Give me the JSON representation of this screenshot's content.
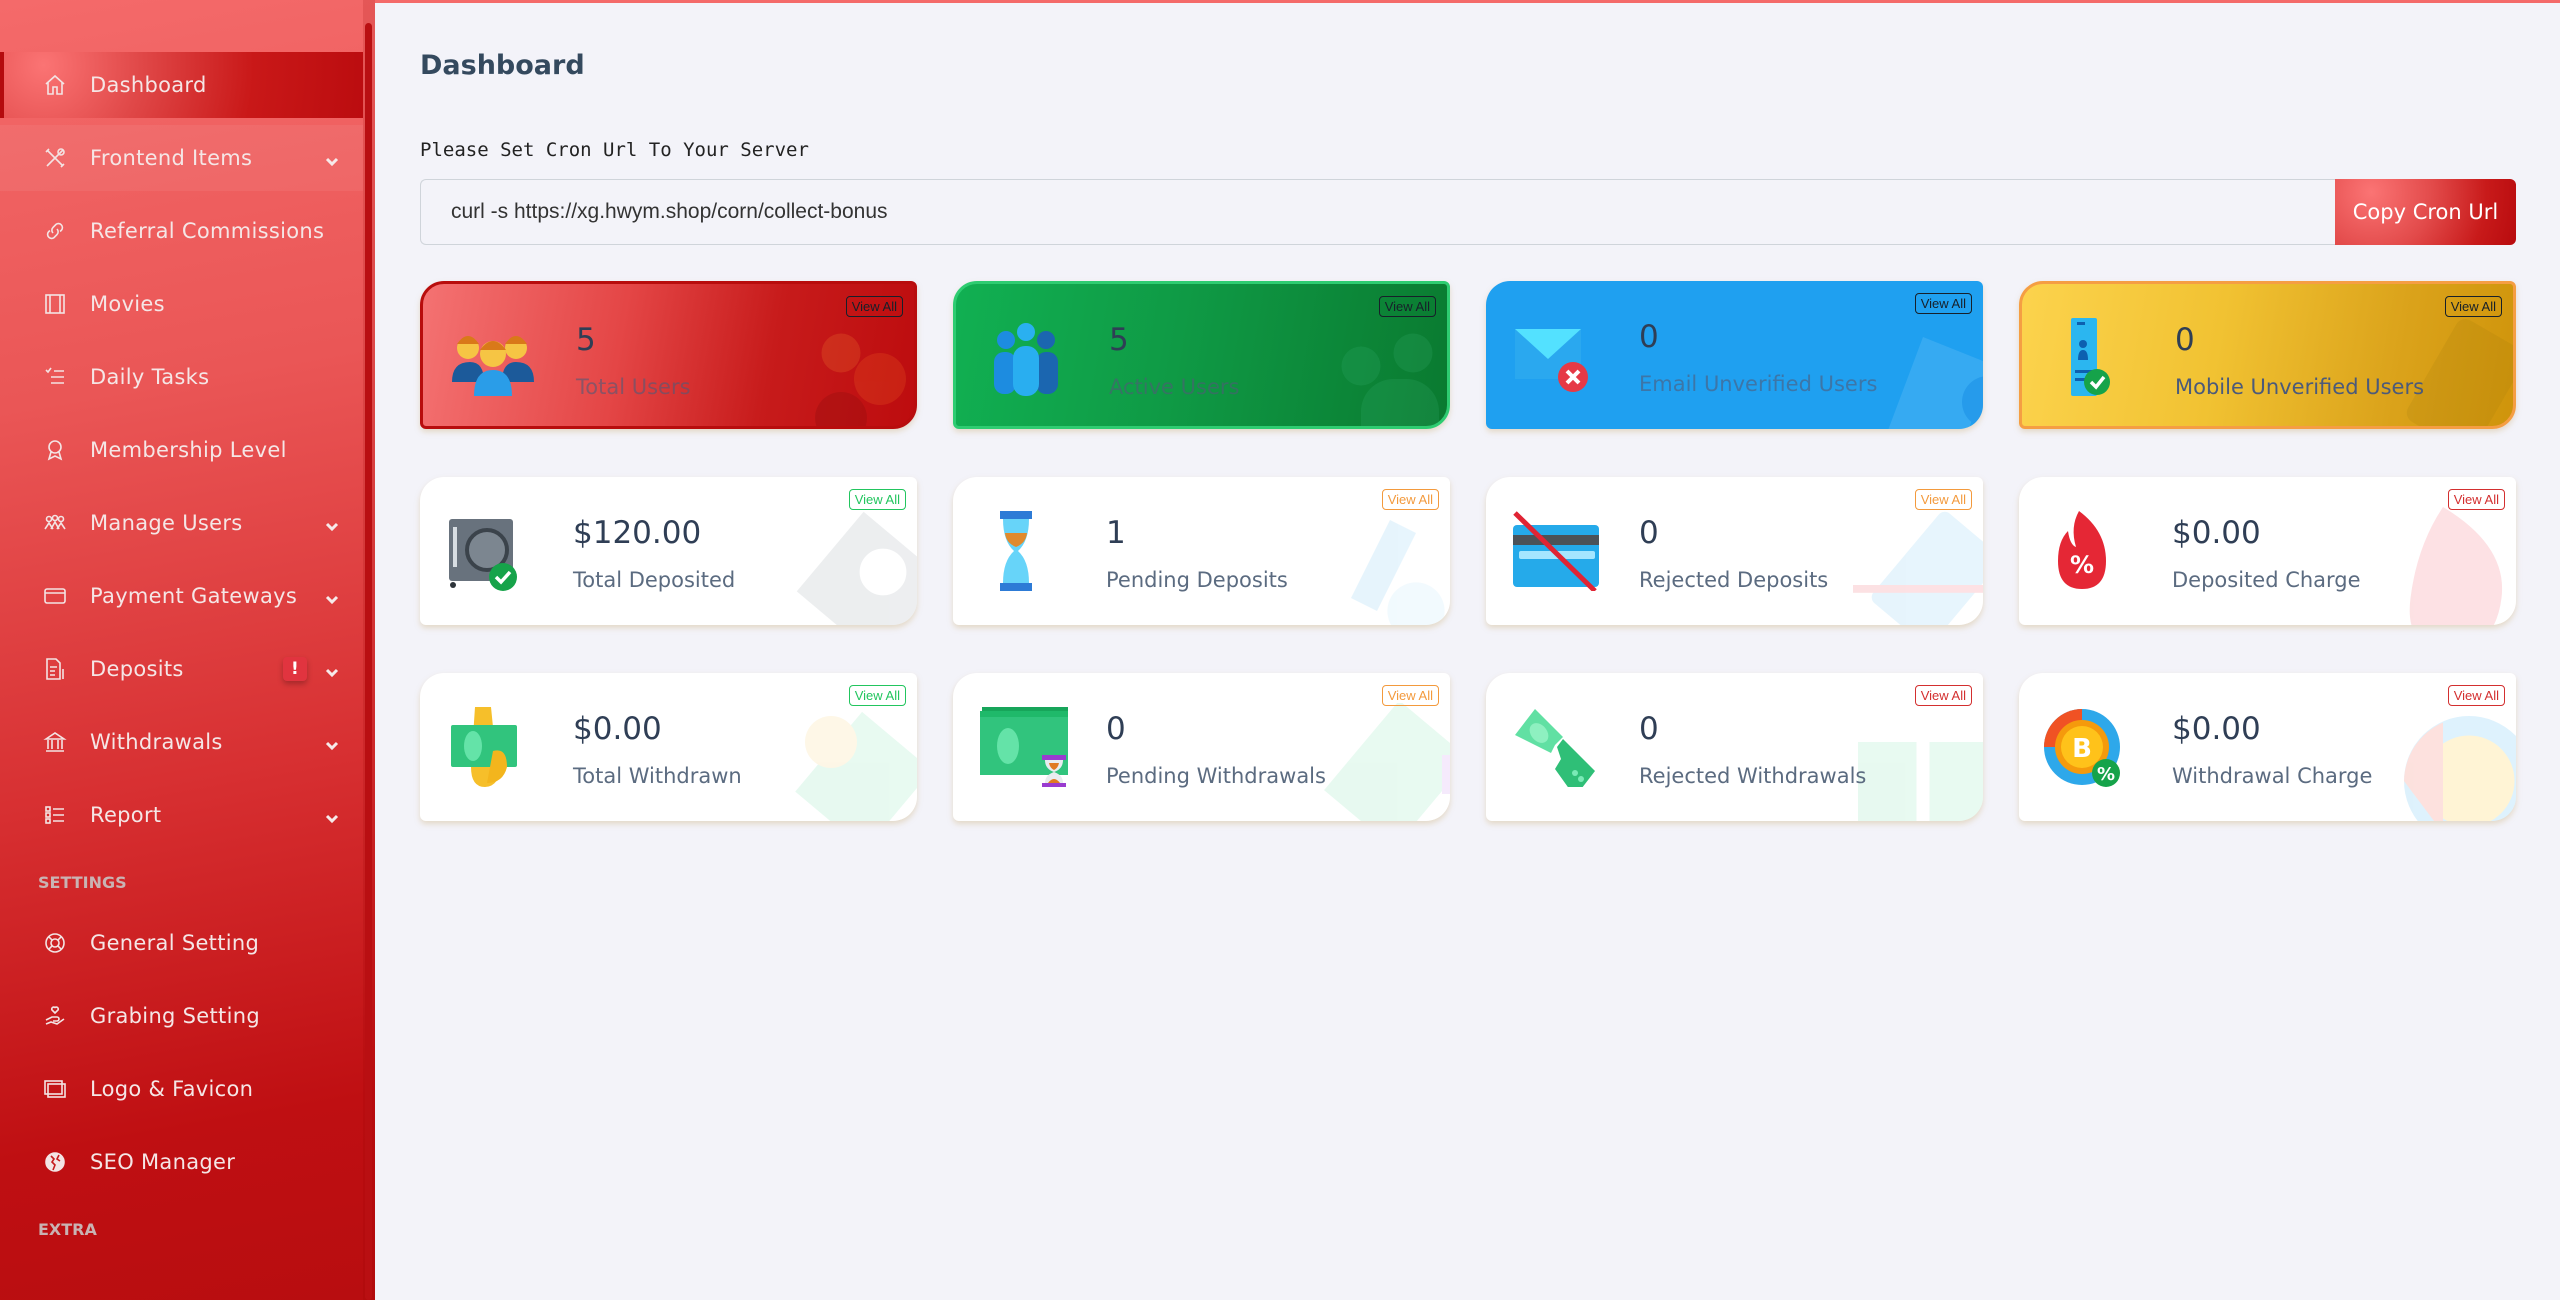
{
  "sidebar": {
    "items": [
      {
        "label": "Dashboard",
        "icon": "home-icon",
        "active": true,
        "has_submenu": false
      },
      {
        "label": "Frontend Items",
        "icon": "tools-icon",
        "has_submenu": true
      },
      {
        "label": "Referral Commissions",
        "icon": "link-icon",
        "has_submenu": false
      },
      {
        "label": "Movies",
        "icon": "film-icon",
        "has_submenu": false
      },
      {
        "label": "Daily Tasks",
        "icon": "checklist-icon",
        "has_submenu": false
      },
      {
        "label": "Membership Level",
        "icon": "award-icon",
        "has_submenu": false
      },
      {
        "label": "Manage Users",
        "icon": "users-icon",
        "has_submenu": true
      },
      {
        "label": "Payment Gateways",
        "icon": "credit-card-icon",
        "has_submenu": true
      },
      {
        "label": "Deposits",
        "icon": "invoice-dollar-icon",
        "has_submenu": true,
        "badge": "!"
      },
      {
        "label": "Withdrawals",
        "icon": "bank-icon",
        "has_submenu": true
      },
      {
        "label": "Report",
        "icon": "list-icon",
        "has_submenu": true
      }
    ],
    "settings_title": "SETTINGS",
    "settings_items": [
      {
        "label": "General Setting",
        "icon": "lifebuoy-icon"
      },
      {
        "label": "Grabing Setting",
        "icon": "hand-heart-icon"
      },
      {
        "label": "Logo & Favicon",
        "icon": "images-icon"
      },
      {
        "label": "SEO Manager",
        "icon": "globe-icon"
      }
    ],
    "extra_title": "EXTRA"
  },
  "header": {
    "title": "Dashboard"
  },
  "cron": {
    "label": "Please Set Cron Url To Your Server",
    "url": "curl -s https://xg.hwym.shop/corn/collect-bonus",
    "button": "Copy Cron Url"
  },
  "cards": [
    {
      "value": "5",
      "label": "Total Users",
      "view_all": "View All",
      "icon": "users-group-icon",
      "style": "red"
    },
    {
      "value": "5",
      "label": "Active Users",
      "view_all": "View All",
      "icon": "active-users-icon",
      "style": "green"
    },
    {
      "value": "0",
      "label": "Email Unverified Users",
      "view_all": "View All",
      "icon": "email-unverified-icon",
      "style": "blue"
    },
    {
      "value": "0",
      "label": "Mobile Unverified Users",
      "view_all": "View All",
      "icon": "mobile-verified-icon",
      "style": "yellow"
    },
    {
      "value": "$120.00",
      "label": "Total Deposited",
      "view_all": "View All",
      "icon": "safe-check-icon",
      "style": "white-green"
    },
    {
      "value": "1",
      "label": "Pending Deposits",
      "view_all": "View All",
      "icon": "hourglass-icon",
      "style": "white-orange"
    },
    {
      "value": "0",
      "label": "Rejected Deposits",
      "view_all": "View All",
      "icon": "card-rejected-icon",
      "style": "white-orange"
    },
    {
      "value": "$0.00",
      "label": "Deposited Charge",
      "view_all": "View All",
      "icon": "fire-percent-icon",
      "style": "white-red"
    },
    {
      "value": "$0.00",
      "label": "Total Withdrawn",
      "view_all": "View All",
      "icon": "hand-cash-icon",
      "style": "white-green"
    },
    {
      "value": "0",
      "label": "Pending Withdrawals",
      "view_all": "View All",
      "icon": "cash-hourglass-icon",
      "style": "white-orange"
    },
    {
      "value": "0",
      "label": "Rejected Withdrawals",
      "view_all": "View All",
      "icon": "torn-cash-icon",
      "style": "white-red"
    },
    {
      "value": "$0.00",
      "label": "Withdrawal Charge",
      "view_all": "View All",
      "icon": "bitcoin-percent-icon",
      "style": "white-red"
    }
  ],
  "colors": {
    "primary": "#e53e3e",
    "sidebar_dark": "#bf0f12",
    "background": "#f3f3f9"
  }
}
